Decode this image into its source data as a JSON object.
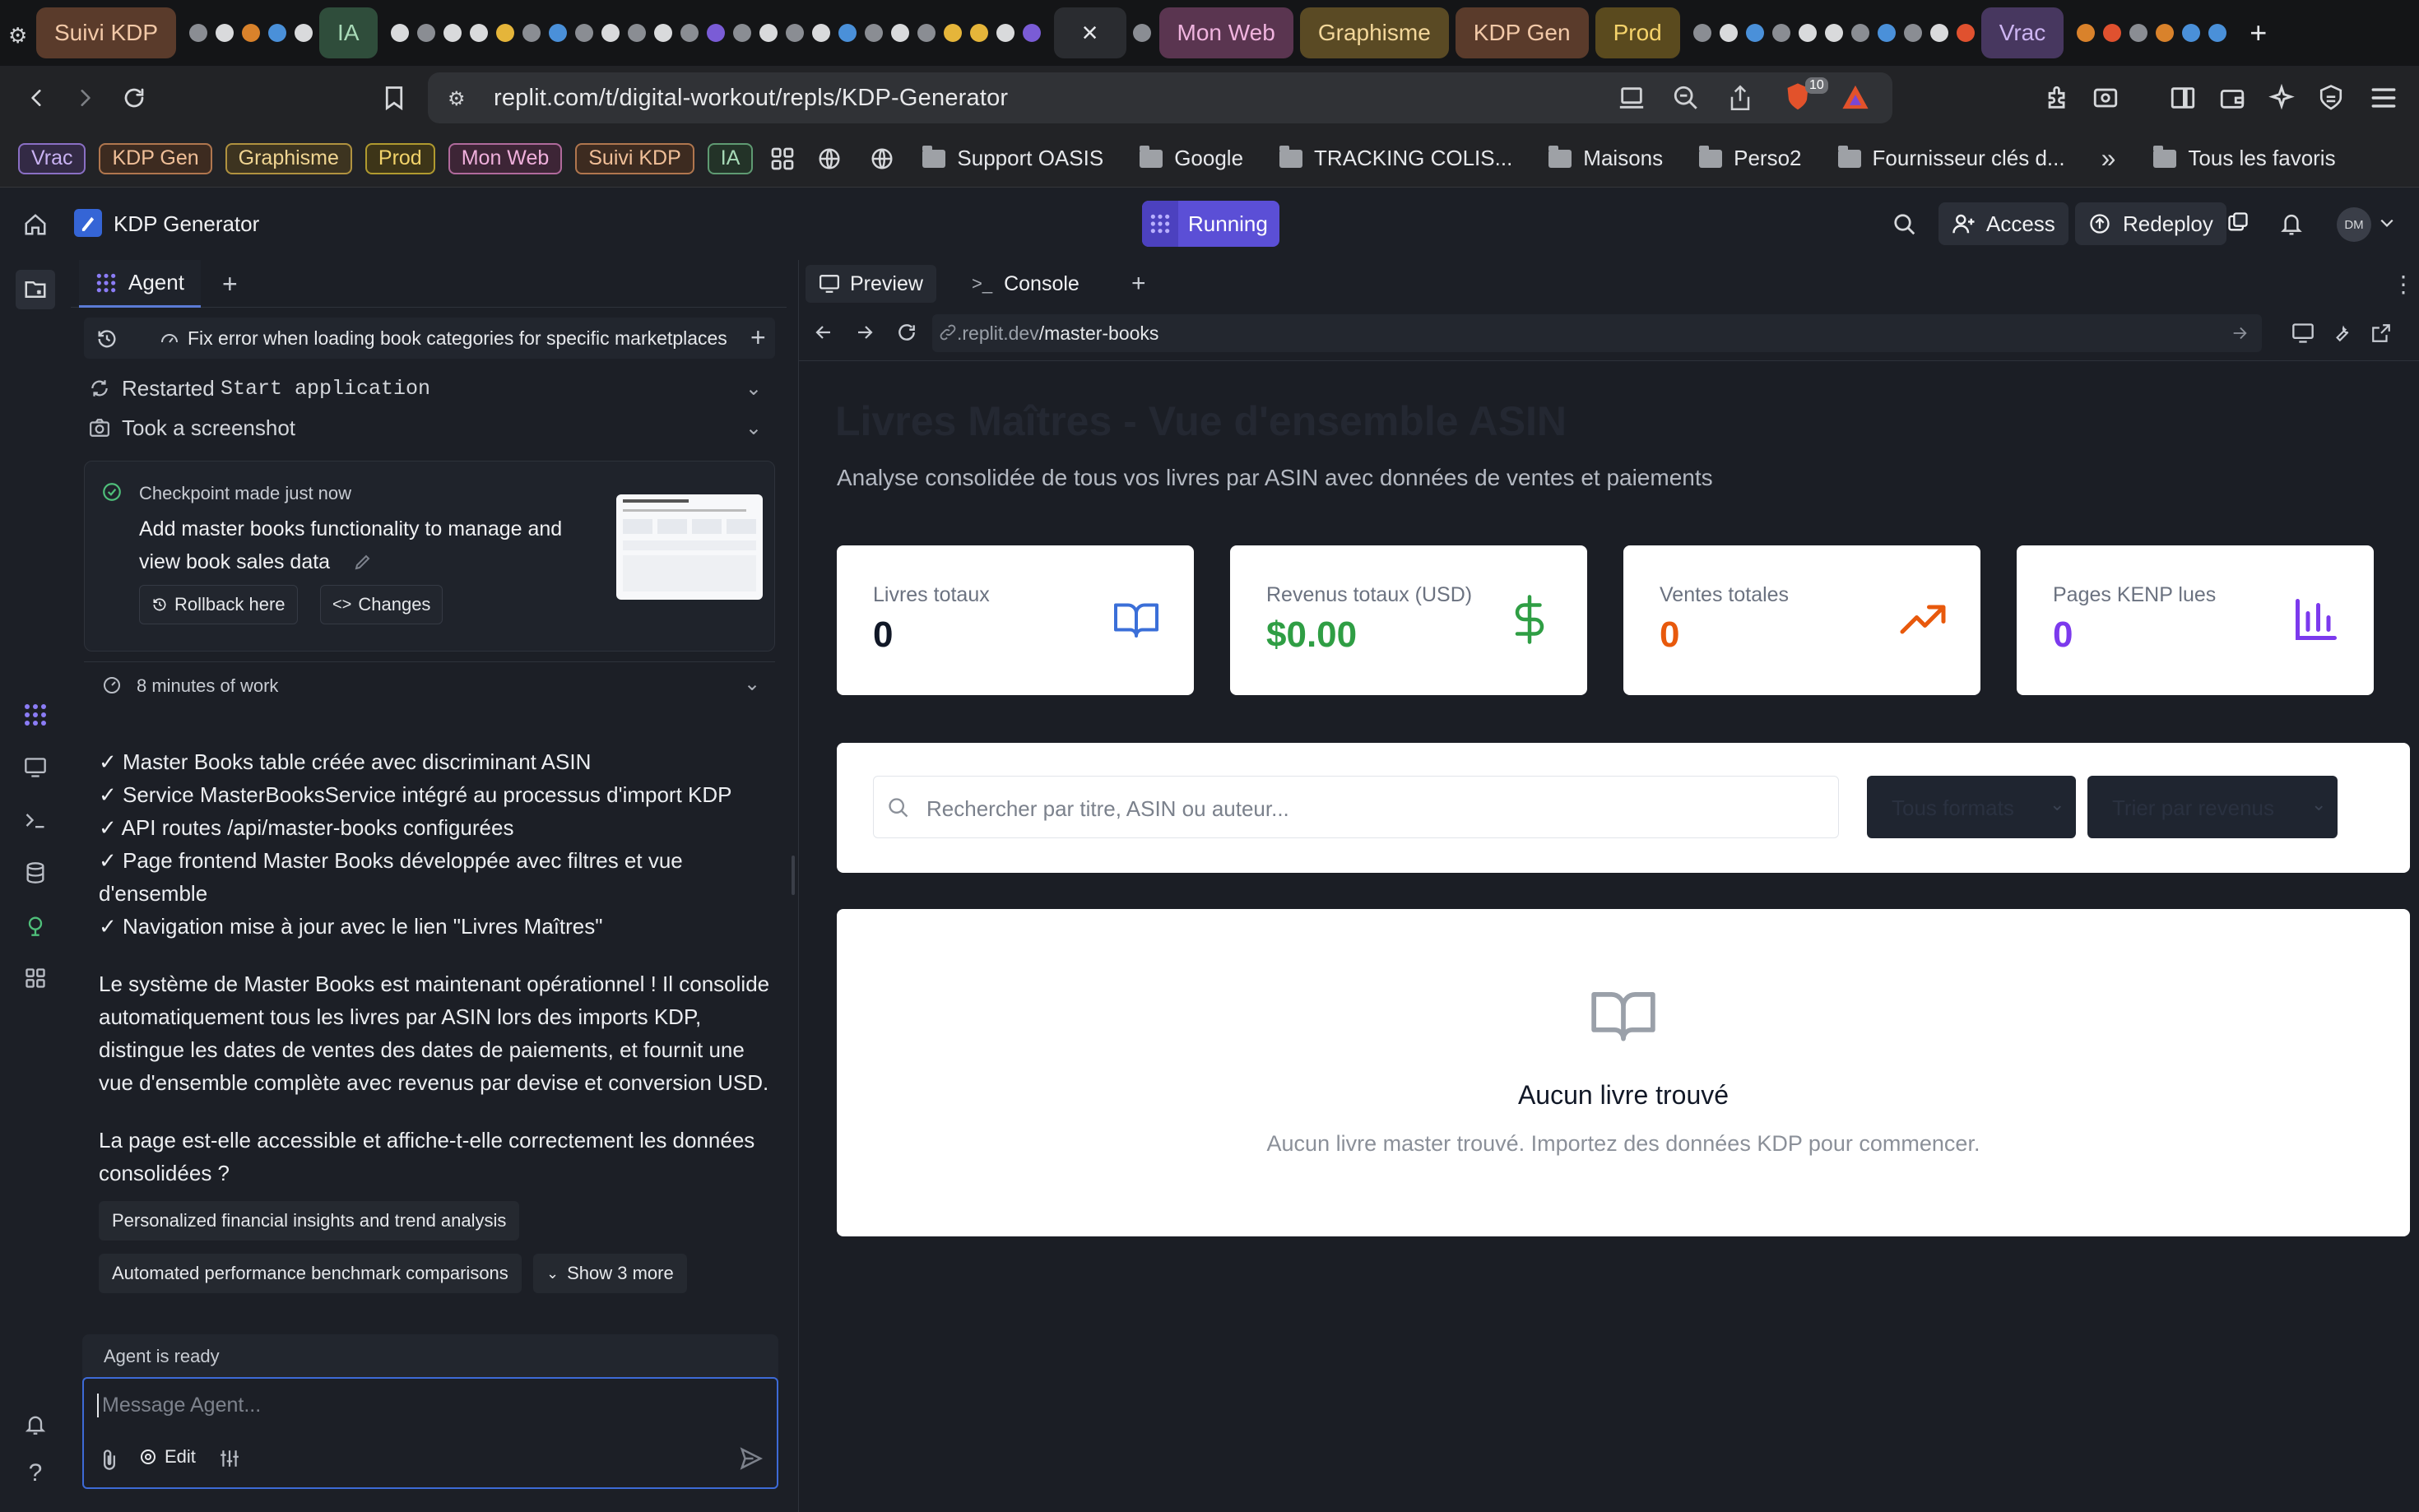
{
  "browser": {
    "tab_groups": [
      {
        "label": "Suivi KDP",
        "bg": "#5a3b2b",
        "fg": "#f2c9a8"
      },
      {
        "label": "IA",
        "bg": "#2f4d3b",
        "fg": "#a9dbb8"
      },
      {
        "label": "Mon Web",
        "bg": "#5a3550",
        "fg": "#f0b4df"
      },
      {
        "label": "Graphisme",
        "bg": "#5a4a24",
        "fg": "#f3d79a"
      },
      {
        "label": "KDP Gen",
        "bg": "#5a3b2b",
        "fg": "#f2c9a8"
      },
      {
        "label": "Prod",
        "bg": "#5a4a1e",
        "fg": "#f5d36b"
      },
      {
        "label": "Vrac",
        "bg": "#47375f",
        "fg": "#cdb5f2"
      }
    ],
    "new_tab": "+",
    "close_tab": "×",
    "url": "replit.com/t/digital-workout/repls/KDP-Generator",
    "shield_count": "10"
  },
  "bookmarks": {
    "chips": [
      {
        "label": "Vrac",
        "color": "#b79ae8"
      },
      {
        "label": "KDP Gen",
        "color": "#e8a878"
      },
      {
        "label": "Graphisme",
        "color": "#e8c870"
      },
      {
        "label": "Prod",
        "color": "#e8c850"
      },
      {
        "label": "Mon Web",
        "color": "#e49ad0"
      },
      {
        "label": "Suivi KDP",
        "color": "#e8a878"
      },
      {
        "label": "IA",
        "color": "#8fcfa4"
      }
    ],
    "folders": [
      "Support OASIS",
      "Google",
      "TRACKING COLIS...",
      "Maisons",
      "Perso2",
      "Fournisseur clés d..."
    ],
    "more": "»",
    "all_bookmarks": "Tous les favoris"
  },
  "replit": {
    "project_name": "KDP Generator",
    "run_status": "Running",
    "access_label": "Access",
    "redeploy_label": "Redeploy",
    "avatar_initials": "DM"
  },
  "agent": {
    "tab_label": "Agent",
    "add_tab": "+",
    "task_title": "Fix error when loading book categories for specific marketplaces",
    "activity": [
      {
        "prefix": "Restarted ",
        "code": "Start application"
      },
      {
        "prefix": "Took a screenshot",
        "code": ""
      }
    ],
    "checkpoint": {
      "status": "Checkpoint made just now",
      "title_line1": "Add master books functionality to manage and",
      "title_line2": "view book sales data",
      "rollback_label": "Rollback here",
      "changes_label": "Changes"
    },
    "work_duration": "8 minutes of work",
    "checklist": [
      "✓ Master Books table créée avec discriminant ASIN",
      "✓ Service MasterBooksService intégré au processus d'import KDP",
      "✓ API routes /api/master-books configurées",
      "✓ Page frontend Master Books développée avec filtres et vue",
      "d'ensemble",
      "✓ Navigation mise à jour avec le lien \"Livres Maîtres\""
    ],
    "summary_lines": [
      "Le système de Master Books est maintenant opérationnel ! Il consolide",
      "automatiquement tous les livres par ASIN lors des imports KDP,",
      "distingue les dates de ventes des dates de paiements, et fournit une",
      "vue d'ensemble complète avec revenus par devise et conversion USD."
    ],
    "question_lines": [
      "La page est-elle accessible et affiche-t-elle correctement les données",
      "consolidées ?"
    ],
    "suggestions": [
      "Personalized financial insights and trend analysis",
      "Automated performance benchmark comparisons"
    ],
    "show_more": "Show 3 more",
    "status": "Agent is ready",
    "input_placeholder": "Message Agent...",
    "edit_label": "Edit"
  },
  "preview": {
    "tabs": [
      "Preview",
      "Console"
    ],
    "add_tab": "+",
    "url_host": ".replit.dev",
    "url_path": "/master-books",
    "page_title": "Livres Maîtres - Vue d'ensemble ASIN",
    "page_subtitle": "Analyse consolidée de tous vos livres par ASIN avec données de ventes et paiements",
    "stats": [
      {
        "label": "Livres totaux",
        "value": "0",
        "color": "#111827",
        "icon": "book-open-icon",
        "icon_color": "#3b6fd8"
      },
      {
        "label": "Revenus totaux (USD)",
        "value": "$0.00",
        "color": "#2f9e44",
        "icon": "dollar-icon",
        "icon_color": "#2f9e44"
      },
      {
        "label": "Ventes totales",
        "value": "0",
        "color": "#e8590c",
        "icon": "trending-up-icon",
        "icon_color": "#e8590c"
      },
      {
        "label": "Pages KENP lues",
        "value": "0",
        "color": "#7c3aed",
        "icon": "bar-chart-icon",
        "icon_color": "#7c3aed"
      }
    ],
    "search_placeholder": "Rechercher par titre, ASIN ou auteur...",
    "format_filter": "Tous formats",
    "sort_filter": "Trier par revenus",
    "empty_title": "Aucun livre trouvé",
    "empty_text": "Aucun livre master trouvé. Importez des données KDP pour commencer."
  }
}
